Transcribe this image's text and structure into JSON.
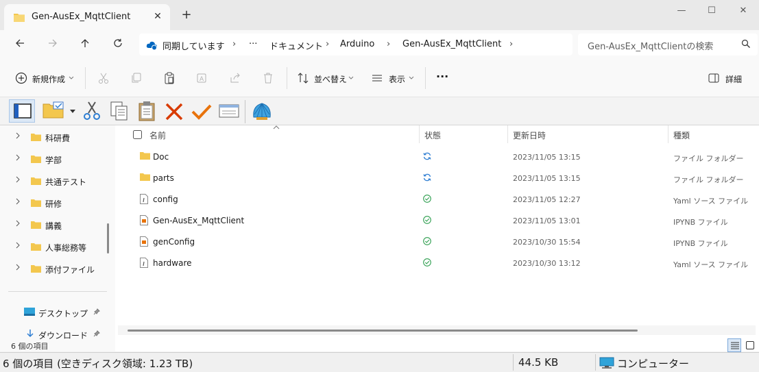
{
  "window": {
    "tab_title": "Gen-AusEx_MqttClient",
    "tab_close": "✕",
    "new_tab": "+",
    "minimize": "—",
    "maximize": "☐",
    "close": "✕"
  },
  "address_bar": {
    "sync_status": "同期しています",
    "overflow": "···",
    "crumbs": [
      "ドキュメント",
      "Arduino",
      "Gen-AusEx_MqttClient"
    ],
    "separator": "›"
  },
  "search": {
    "placeholder": "Gen-AusEx_MqttClientの検索"
  },
  "command_bar": {
    "new_label": "新規作成",
    "sort_label": "並べ替え",
    "view_label": "表示",
    "more_label": "···",
    "details_label": "詳細"
  },
  "sidebar": {
    "items": [
      {
        "label": "科研費"
      },
      {
        "label": "学部"
      },
      {
        "label": "共通テスト"
      },
      {
        "label": "研修"
      },
      {
        "label": "講義"
      },
      {
        "label": "人事総務等"
      },
      {
        "label": "添付ファイル"
      }
    ],
    "pinned": [
      {
        "label": "デスクトップ"
      },
      {
        "label": "ダウンロード"
      }
    ],
    "item_count": "6 個の項目"
  },
  "columns": {
    "name": "名前",
    "status": "状態",
    "date": "更新日時",
    "type": "種類"
  },
  "files": [
    {
      "name": "Doc",
      "icon": "folder-icon",
      "status": "sync",
      "date": "2023/11/05 13:15",
      "type": "ファイル フォルダー"
    },
    {
      "name": "parts",
      "icon": "folder-icon",
      "status": "sync",
      "date": "2023/11/05 13:15",
      "type": "ファイル フォルダー"
    },
    {
      "name": "config",
      "icon": "yaml-file-icon",
      "status": "available",
      "date": "2023/11/05 12:27",
      "type": "Yaml ソース ファイル"
    },
    {
      "name": "Gen-AusEx_MqttClient",
      "icon": "ipynb-file-icon",
      "status": "available",
      "date": "2023/11/05 13:01",
      "type": "IPYNB ファイル"
    },
    {
      "name": "genConfig",
      "icon": "ipynb-file-icon",
      "status": "available",
      "date": "2023/10/30 15:54",
      "type": "IPYNB ファイル"
    },
    {
      "name": "hardware",
      "icon": "yaml-file-icon",
      "status": "available",
      "date": "2023/10/30 13:12",
      "type": "Yaml ソース ファイル"
    }
  ],
  "status_bar": {
    "summary": "6 個の項目 (空きディスク領域: 1.23 TB)",
    "size": "44.5 KB",
    "location": "コンピューター"
  },
  "colors": {
    "accent": "#0067c0",
    "folder": "#f3c74e",
    "sync_blue": "#2d7dd2",
    "ok_green": "#2e9e4f",
    "delete_red": "#d83b01",
    "check_orange": "#e8730c"
  }
}
